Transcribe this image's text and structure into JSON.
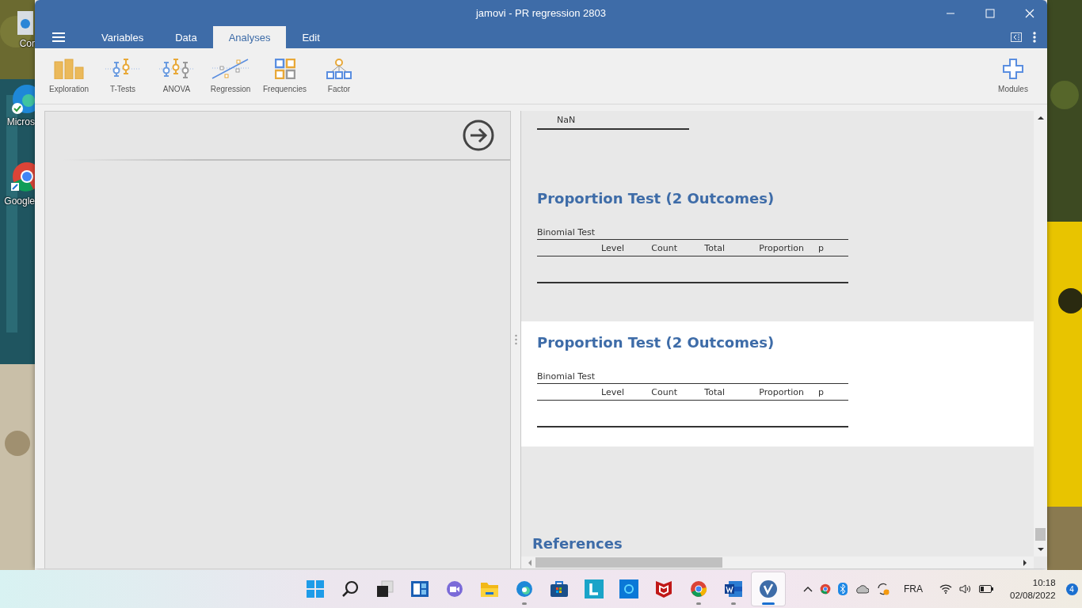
{
  "desktop_icons": [
    {
      "kind": "recycle",
      "label": "Cor"
    },
    {
      "kind": "edge",
      "label": "Micros"
    },
    {
      "kind": "chrome",
      "label": "Google"
    }
  ],
  "window": {
    "title": "jamovi - PR regression 2803"
  },
  "menu_tabs": [
    {
      "label": "Variables",
      "selected": false
    },
    {
      "label": "Data",
      "selected": false
    },
    {
      "label": "Analyses",
      "selected": true
    },
    {
      "label": "Edit",
      "selected": false
    }
  ],
  "toolbar": [
    {
      "kind": "exploration",
      "label": "Exploration"
    },
    {
      "kind": "ttests",
      "label": "T-Tests"
    },
    {
      "kind": "anova",
      "label": "ANOVA"
    },
    {
      "kind": "regression",
      "label": "Regression"
    },
    {
      "kind": "frequencies",
      "label": "Frequencies"
    },
    {
      "kind": "factor",
      "label": "Factor"
    }
  ],
  "modules": {
    "label": "Modules"
  },
  "results": {
    "top_value": "NaN",
    "tables": [
      {
        "heading": "Proportion Test (2 Outcomes)",
        "subtitle": "Binomial Test",
        "columns": [
          "Level",
          "Count",
          "Total",
          "Proportion",
          "p"
        ],
        "selected": false
      },
      {
        "heading": "Proportion Test (2 Outcomes)",
        "subtitle": "Binomial Test",
        "columns": [
          "Level",
          "Count",
          "Total",
          "Proportion",
          "p"
        ],
        "selected": true
      }
    ],
    "references_heading": "References"
  },
  "taskbar": {
    "apps": [
      {
        "kind": "start",
        "running": false,
        "selected": false
      },
      {
        "kind": "search",
        "running": false,
        "selected": false
      },
      {
        "kind": "taskview",
        "running": false,
        "selected": false
      },
      {
        "kind": "widgets",
        "running": false,
        "selected": false
      },
      {
        "kind": "chat",
        "running": false,
        "selected": false
      },
      {
        "kind": "explorer",
        "running": false,
        "selected": false
      },
      {
        "kind": "edge",
        "running": true,
        "selected": false
      },
      {
        "kind": "store",
        "running": false,
        "selected": false
      },
      {
        "kind": "lapp",
        "running": false,
        "selected": false
      },
      {
        "kind": "cortana",
        "running": false,
        "selected": false
      },
      {
        "kind": "mcafee",
        "running": false,
        "selected": false
      },
      {
        "kind": "chrome",
        "running": true,
        "selected": false
      },
      {
        "kind": "word",
        "running": true,
        "selected": false
      },
      {
        "kind": "jamovi",
        "running": true,
        "selected": true
      }
    ],
    "language": "FRA",
    "time": "10:18",
    "date": "02/08/2022",
    "notifications": "4"
  }
}
